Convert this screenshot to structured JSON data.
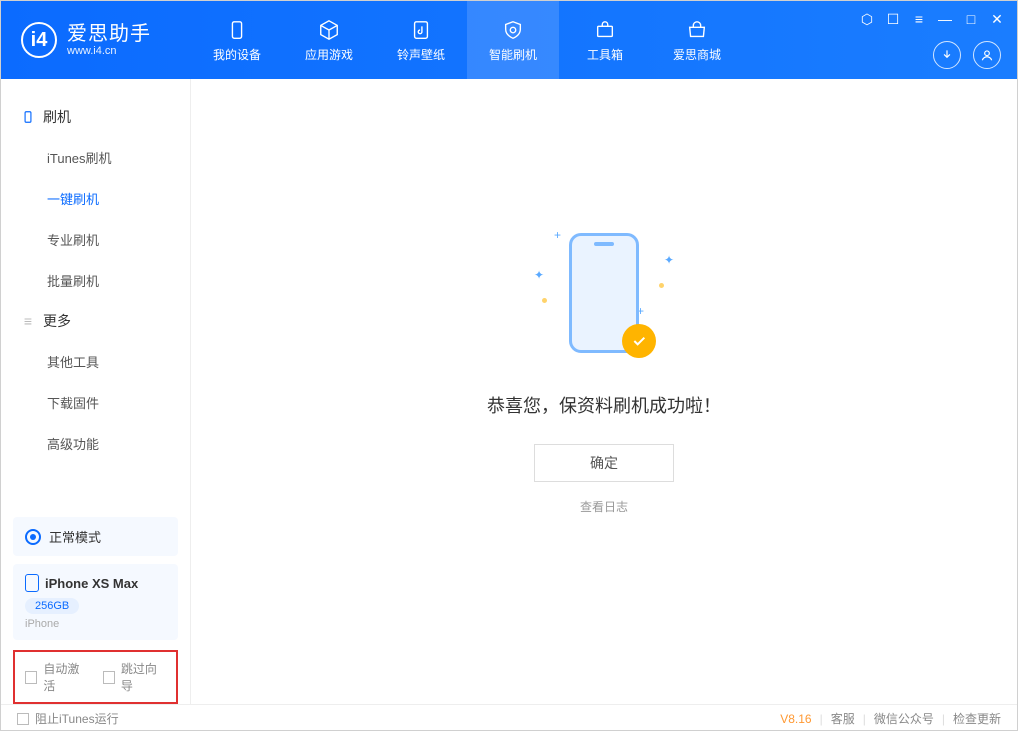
{
  "app": {
    "name_cn": "爱思助手",
    "name_en": "www.i4.cn"
  },
  "nav": {
    "items": [
      {
        "label": "我的设备"
      },
      {
        "label": "应用游戏"
      },
      {
        "label": "铃声壁纸"
      },
      {
        "label": "智能刷机"
      },
      {
        "label": "工具箱"
      },
      {
        "label": "爱思商城"
      }
    ]
  },
  "sidebar": {
    "section1_title": "刷机",
    "section1_items": [
      {
        "label": "iTunes刷机"
      },
      {
        "label": "一键刷机"
      },
      {
        "label": "专业刷机"
      },
      {
        "label": "批量刷机"
      }
    ],
    "section2_title": "更多",
    "section2_items": [
      {
        "label": "其他工具"
      },
      {
        "label": "下载固件"
      },
      {
        "label": "高级功能"
      }
    ],
    "status_mode": "正常模式",
    "device": {
      "name": "iPhone XS Max",
      "capacity": "256GB",
      "type": "iPhone"
    },
    "checkbox1": "自动激活",
    "checkbox2": "跳过向导"
  },
  "main": {
    "success_text": "恭喜您，保资料刷机成功啦！",
    "ok_button": "确定",
    "log_link": "查看日志"
  },
  "footer": {
    "stop_itunes": "阻止iTunes运行",
    "version": "V8.16",
    "link1": "客服",
    "link2": "微信公众号",
    "link3": "检查更新"
  }
}
